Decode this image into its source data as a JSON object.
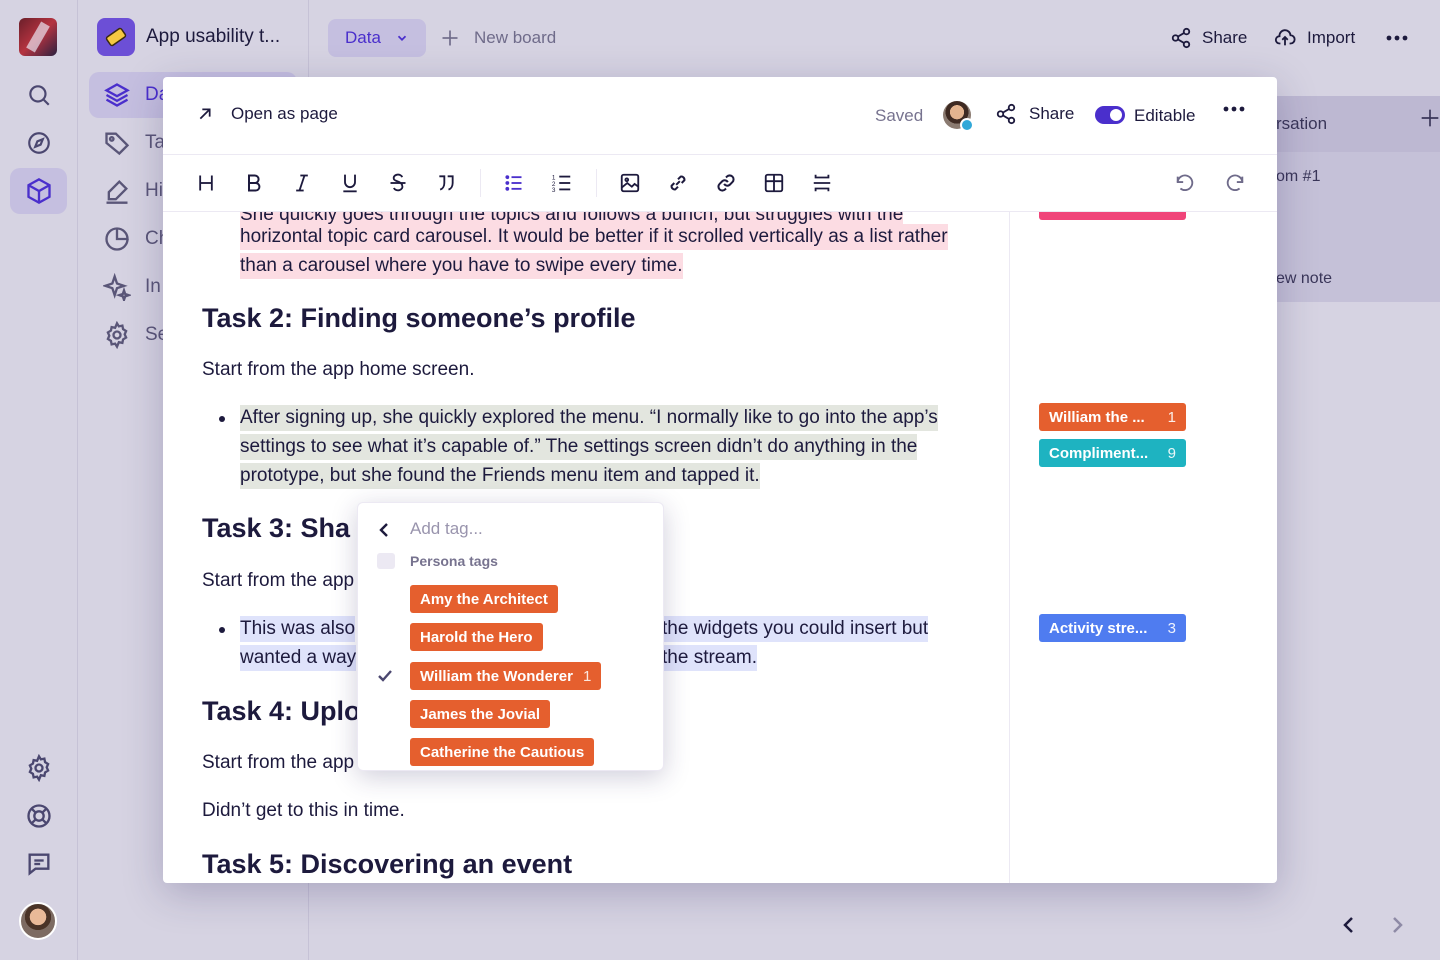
{
  "workspace": {
    "title": "App usability t..."
  },
  "nav": {
    "items": [
      {
        "label": "Da"
      },
      {
        "label": "Ta"
      },
      {
        "label": "Hi"
      },
      {
        "label": "Ch"
      },
      {
        "label": "In"
      },
      {
        "label": "Se"
      }
    ]
  },
  "topbar": {
    "view_label": "Data",
    "new_board_label": "New board",
    "share_label": "Share",
    "import_label": "Import"
  },
  "board": {
    "column_title": "rsation",
    "row1": "om #1",
    "row2": "ew note"
  },
  "modal": {
    "open_as_page": "Open as page",
    "saved": "Saved",
    "share": "Share",
    "editable": "Editable"
  },
  "doc": {
    "cut_line": "She quickly goes through the topics and follows a bunch, but struggles with the",
    "p1": "horizontal topic card carousel. It would be better if it scrolled vertically as a list rather than a carousel where you have to swipe every time.",
    "task2_title": "Task 2: Finding someone’s profile",
    "task2_start": "Start from the app home screen.",
    "task2_bullet": "After signing up, she quickly explored the menu. “I normally like to go into the app’s settings to see what it’s capable of.” The settings screen didn’t do anything in the prototype, but she found the Friends menu item and tapped it.",
    "task3_title": "Task 3: Sha",
    "task3_start": "Start from the app",
    "task3_bullet_a": "This was also",
    "task3_bullet_b": "wanted a way",
    "task3_bullet_c": "the widgets you could insert but",
    "task3_bullet_d": "the stream.",
    "task4_title": "Task 4: Uplo",
    "task4_start": "Start from the app",
    "task4_note": "Didn’t get to this in time.",
    "task5_title": "Task 5: Discovering an event"
  },
  "side_tags": [
    {
      "label": "William the ...",
      "count": "1",
      "color": "#e55f2e"
    },
    {
      "label": "Compliment...",
      "count": "9",
      "color": "#1eb3c1"
    },
    {
      "label": "Activity stre...",
      "count": "3",
      "color": "#4f7cf0"
    }
  ],
  "dropdown": {
    "search_placeholder": "Add tag...",
    "group_label": "Persona tags",
    "tags": [
      {
        "label": "Amy the Architect",
        "count": "",
        "checked": false
      },
      {
        "label": "Harold the Hero",
        "count": "",
        "checked": false
      },
      {
        "label": "William the Wonderer",
        "count": "1",
        "checked": true
      },
      {
        "label": "James the Jovial",
        "count": "",
        "checked": false
      },
      {
        "label": "Catherine the Cautious",
        "count": "",
        "checked": false
      }
    ]
  },
  "colors": {
    "accent": "#4a2fcc",
    "persona_tag": "#e55f2e",
    "pink_top_tag": "#f0447a"
  }
}
